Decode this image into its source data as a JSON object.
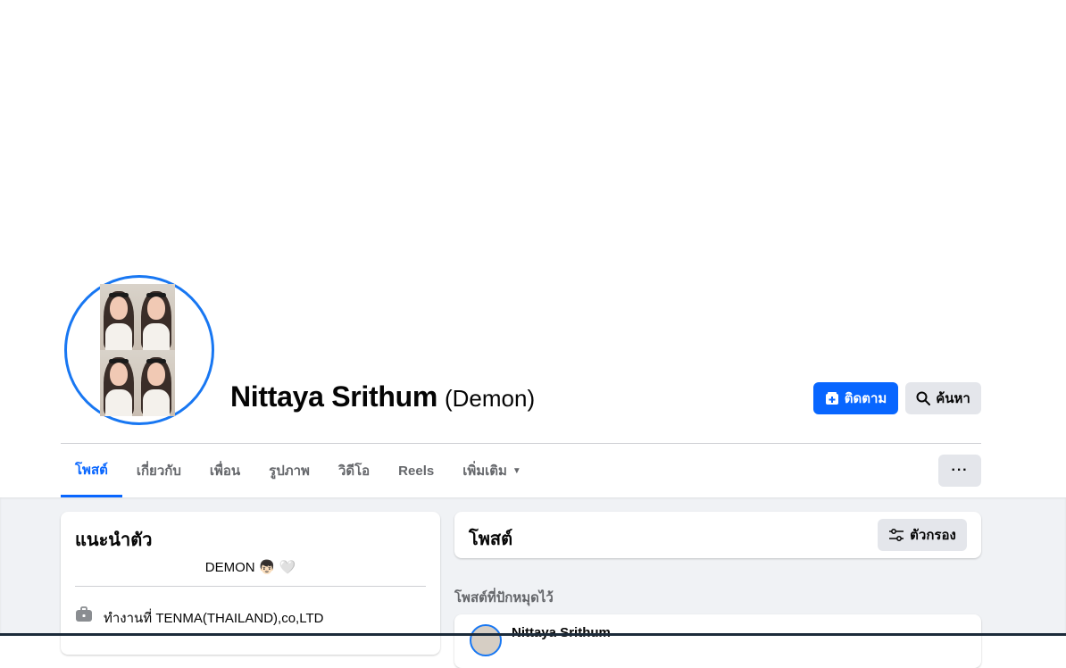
{
  "profile": {
    "name": "Nittaya Srithum",
    "nickname": "(Demon)"
  },
  "actions": {
    "follow_label": "ติดตาม",
    "search_label": "ค้นหา",
    "more_label": "···"
  },
  "tabs": [
    {
      "label": "โพสต์",
      "active": true
    },
    {
      "label": "เกี่ยวกับ"
    },
    {
      "label": "เพื่อน"
    },
    {
      "label": "รูปภาพ"
    },
    {
      "label": "วิดีโอ"
    },
    {
      "label": "Reels"
    },
    {
      "label": "เพิ่มเติม"
    }
  ],
  "intro": {
    "title": "แนะนำตัว",
    "bio": "DEMON 👦🏻 🤍",
    "work": "ทำงานที่ TENMA(THAILAND),co,LTD"
  },
  "posts": {
    "title": "โพสต์",
    "filter_label": "ตัวกรอง",
    "pinned_label": "โพสต์ที่ปักหมุดไว้",
    "pinned_author": "Nittaya Srithum"
  },
  "colors": {
    "accent": "#0866ff",
    "ring": "#1877f2",
    "secondary_button": "#e4e6eb",
    "page_bg": "#f0f2f5"
  }
}
